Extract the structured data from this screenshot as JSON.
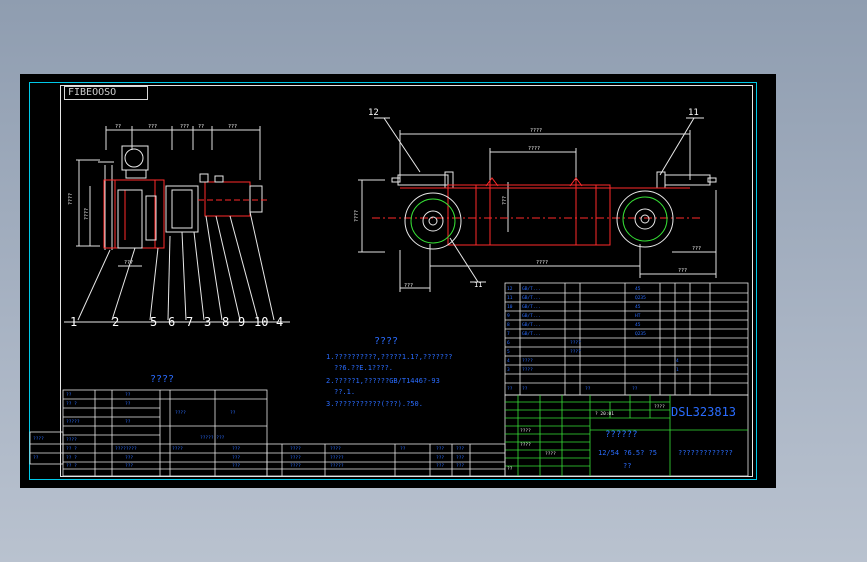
{
  "title_tag": "FIBEOOSO",
  "left_view": {
    "top_dims": [
      "??",
      "???",
      "???",
      "??",
      "???"
    ],
    "left_dim": "????",
    "inner_dim": "????",
    "bottom_dim": "???",
    "balloons": [
      "1",
      "2",
      "5",
      "6",
      "7",
      "3",
      "8",
      "9",
      "10",
      "4"
    ]
  },
  "right_view": {
    "balloons": [
      "12",
      "11",
      "11"
    ],
    "top_dim": "????",
    "inner_dim": "????",
    "left_dim": "????",
    "mid_dim": "???",
    "bottom_dims": [
      "???",
      "????"
    ],
    "right_dims": [
      "???",
      "???"
    ]
  },
  "notes": {
    "header": "????",
    "lines": [
      "1.??????????,?????1.1?,???????",
      "??6.??E.1????.",
      "2.?????1,??????GB/T1446?-93",
      "??.1.",
      "3.???????????(???).?50."
    ]
  },
  "bom_title": "????",
  "part_code": "DSL323813",
  "drawing_name": "??????",
  "drawing_sub": "12/54   ?6.5?   ?5",
  "drawing_sub2": "??",
  "company": "?????????????",
  "colors": {
    "frame_outer": "#00c8e8",
    "frame_inner": "#e6e6e6",
    "dimension": "#2a6cff",
    "structure": "#ff2a2a",
    "wheel_outline": "#e8e8e8",
    "table_green": "#36e036"
  }
}
